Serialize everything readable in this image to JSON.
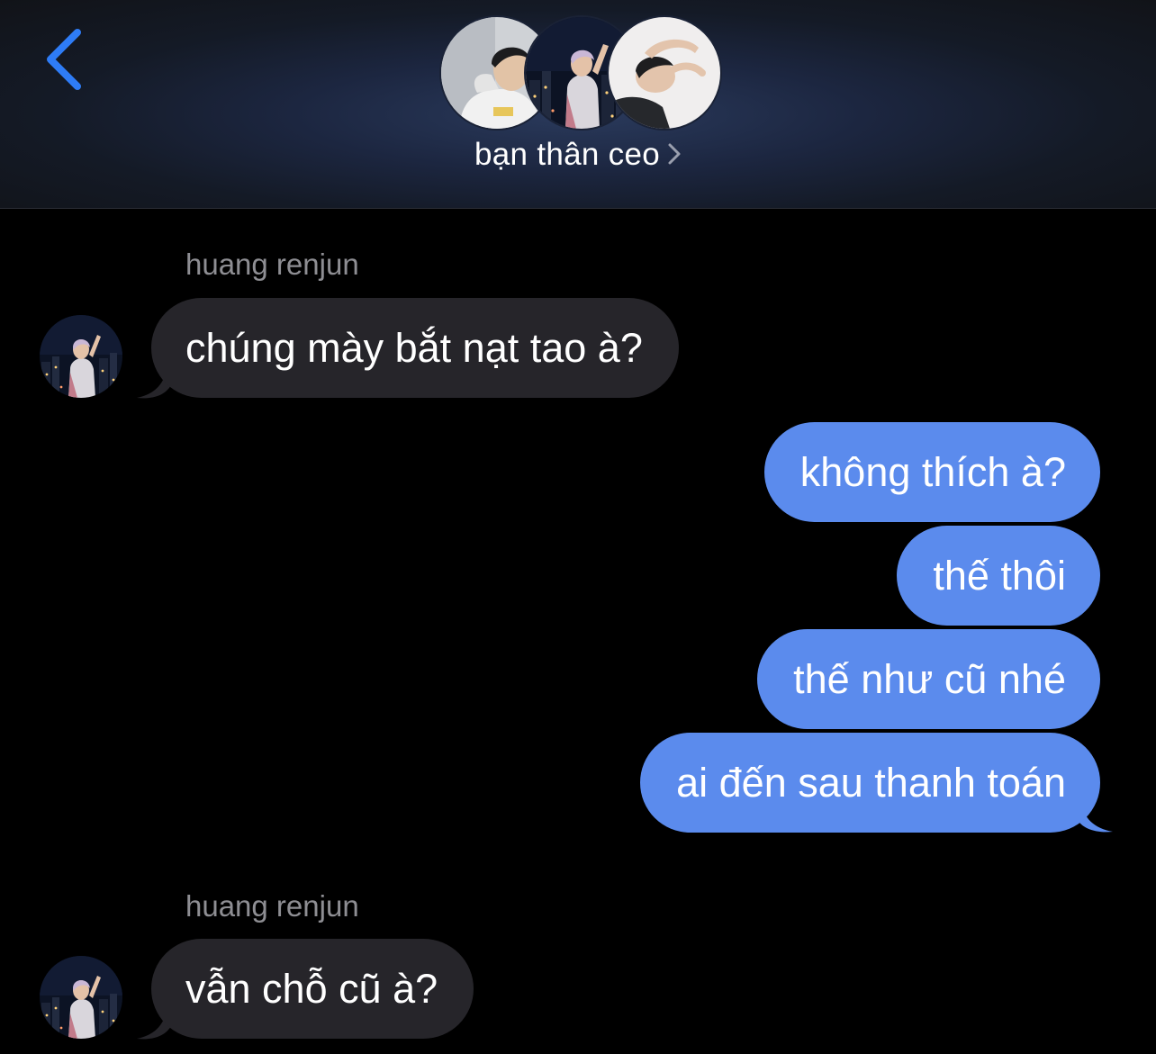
{
  "header": {
    "back_icon": "chevron-left-icon",
    "group_name": "bạn thân ceo",
    "disclosure_icon": "chevron-right-icon",
    "accent_color": "#2e7cf6"
  },
  "messages": [
    {
      "direction": "incoming",
      "sender": "huang renjun",
      "text": "chúng mày bắt nạt tao à?"
    },
    {
      "direction": "outgoing",
      "text": "không thích à?"
    },
    {
      "direction": "outgoing",
      "text": "thế thôi"
    },
    {
      "direction": "outgoing",
      "text": "thế như cũ nhé"
    },
    {
      "direction": "outgoing",
      "text": "ai đến sau thanh toán"
    },
    {
      "direction": "incoming",
      "sender": "huang renjun",
      "text": "vẫn chỗ cũ à?"
    }
  ],
  "colors": {
    "incoming_bubble": "#26252a",
    "outgoing_bubble": "#5b8bed",
    "sender_label": "#8e8e93"
  }
}
